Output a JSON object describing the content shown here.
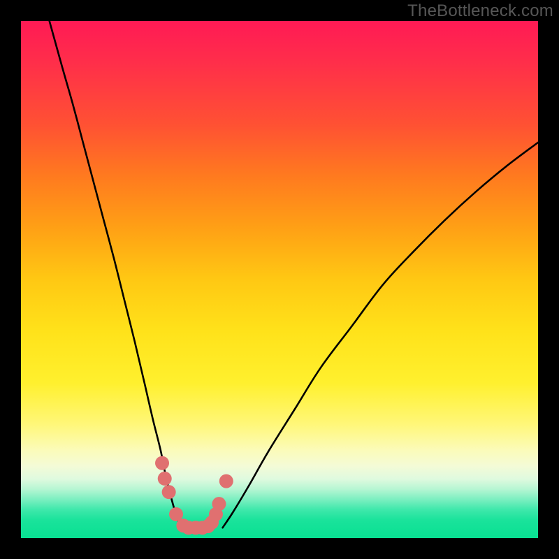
{
  "watermark": "TheBottleneck.com",
  "chart_data": {
    "type": "line",
    "title": "",
    "xlabel": "",
    "ylabel": "",
    "xlim": [
      0,
      100
    ],
    "ylim": [
      0,
      100
    ],
    "series": [
      {
        "name": "left-curve",
        "x": [
          5.5,
          8,
          10,
          12,
          14,
          16,
          18,
          20,
          22,
          24,
          25.5,
          27,
          28,
          29,
          30,
          31
        ],
        "y": [
          100,
          91,
          84,
          76.5,
          69,
          61.5,
          54,
          46,
          38,
          29.5,
          23,
          17,
          12,
          8,
          4.5,
          2
        ]
      },
      {
        "name": "right-curve",
        "x": [
          39,
          41,
          44,
          48,
          53,
          58,
          64,
          70,
          76,
          82,
          88,
          94,
          100
        ],
        "y": [
          2,
          5,
          10,
          17,
          25,
          33,
          41,
          49,
          55.5,
          61.5,
          67,
          72,
          76.5
        ]
      },
      {
        "name": "markers",
        "x": [
          27.3,
          27.8,
          28.6,
          30.0,
          31.4,
          32.4,
          33.8,
          35.1,
          36.2,
          36.9,
          37.7,
          38.3,
          39.7
        ],
        "y": [
          14.5,
          11.5,
          8.9,
          4.6,
          2.4,
          2.0,
          2.0,
          2.0,
          2.3,
          3.0,
          4.6,
          6.6,
          11.0
        ]
      }
    ],
    "gradient_stops": [
      {
        "pos": 0,
        "color": "#ff1a55"
      },
      {
        "pos": 8,
        "color": "#ff2e4a"
      },
      {
        "pos": 20,
        "color": "#ff5133"
      },
      {
        "pos": 30,
        "color": "#ff7a1f"
      },
      {
        "pos": 40,
        "color": "#ffa015"
      },
      {
        "pos": 50,
        "color": "#ffc813"
      },
      {
        "pos": 60,
        "color": "#ffe21a"
      },
      {
        "pos": 70,
        "color": "#fff02e"
      },
      {
        "pos": 78,
        "color": "#fff779"
      },
      {
        "pos": 83,
        "color": "#fbfbb9"
      },
      {
        "pos": 86,
        "color": "#f4fbd6"
      },
      {
        "pos": 88.5,
        "color": "#e0fadf"
      },
      {
        "pos": 90.5,
        "color": "#b7f6d3"
      },
      {
        "pos": 92.5,
        "color": "#7cefc1"
      },
      {
        "pos": 94.5,
        "color": "#3fe8ab"
      },
      {
        "pos": 96.5,
        "color": "#1ae39b"
      },
      {
        "pos": 100,
        "color": "#08e092"
      }
    ],
    "curve_color": "#000000",
    "marker_color": "#e07070",
    "marker_radius": 10
  }
}
